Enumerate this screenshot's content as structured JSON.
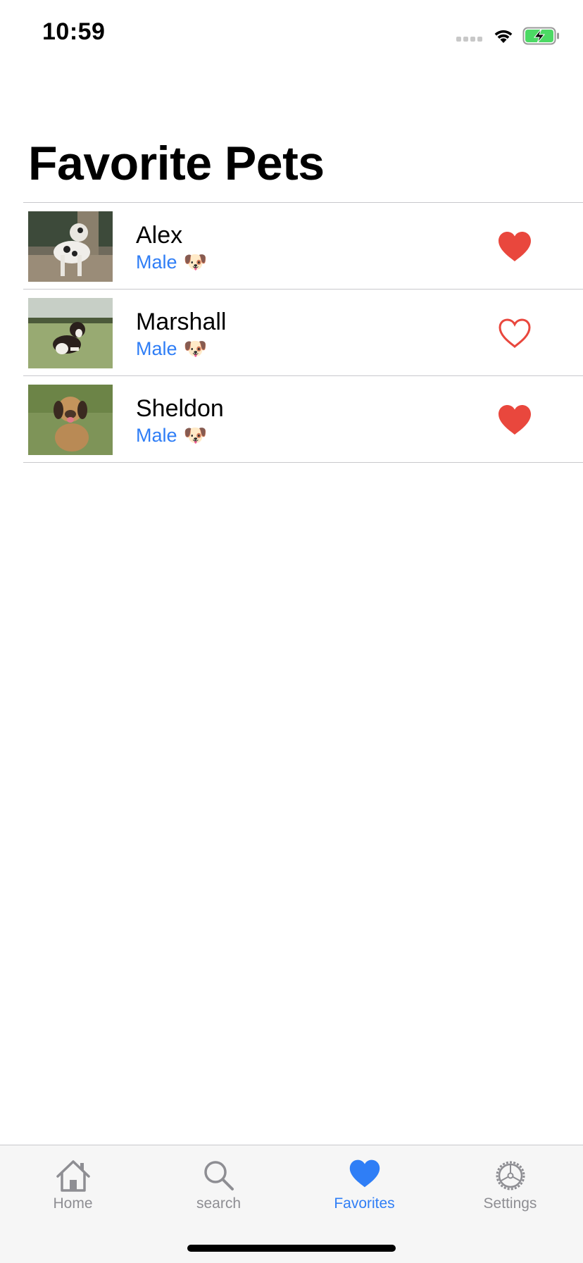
{
  "status_bar": {
    "time": "10:59",
    "icons": [
      "signal-icon",
      "wifi-icon",
      "battery-charging-icon"
    ]
  },
  "page": {
    "title": "Favorite Pets"
  },
  "pets": [
    {
      "name": "Alex",
      "gender": "Male",
      "species_emoji": "🐶",
      "favorited": true
    },
    {
      "name": "Marshall",
      "gender": "Male",
      "species_emoji": "🐶",
      "favorited": false
    },
    {
      "name": "Sheldon",
      "gender": "Male",
      "species_emoji": "🐶",
      "favorited": true
    }
  ],
  "tab_bar": {
    "tabs": [
      {
        "label": "Home",
        "icon": "house-icon",
        "active": false
      },
      {
        "label": "search",
        "icon": "magnifying-glass-icon",
        "active": false
      },
      {
        "label": "Favorites",
        "icon": "heart-icon",
        "active": true
      },
      {
        "label": "Settings",
        "icon": "gear-icon",
        "active": false
      }
    ]
  },
  "colors": {
    "accent": "#2f7ef6",
    "heart": "#e9473d",
    "inactive_tab": "#8e8e93",
    "battery": "#4cd964"
  }
}
